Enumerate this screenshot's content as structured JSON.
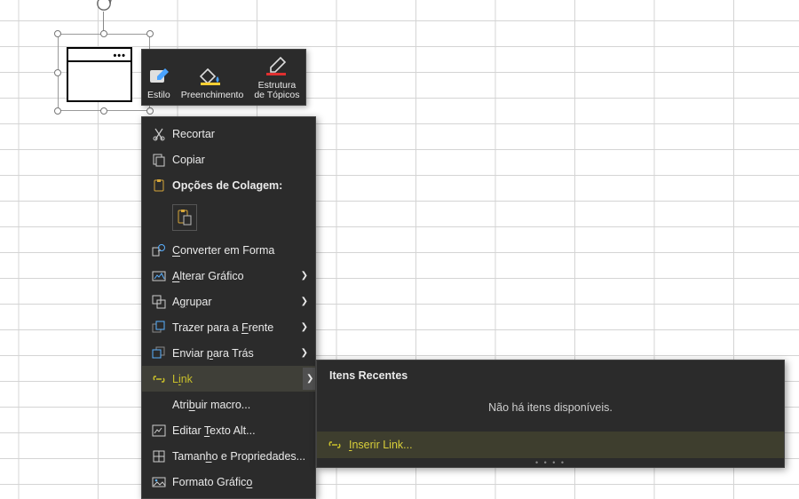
{
  "miniToolbar": {
    "style": "Estilo",
    "fill": "Preenchimento",
    "outline": "Estrutura\nde Tópicos"
  },
  "ctx": {
    "cut": "Recortar",
    "copy": "Copiar",
    "pasteOptions": "Opções de Colagem:",
    "convertToShape": "Converter em Forma",
    "changeGraphic": "Alterar Gráfico",
    "group": "Agrupar",
    "bringFront": "Trazer para a Frente",
    "sendBack": "Enviar para Trás",
    "link": "Link",
    "assignMacro": "Atribuir macro...",
    "editAltText": "Editar Texto Alt...",
    "sizeProps": "Tamanho e Propriedades...",
    "formatGraphic": "Formato Gráfico"
  },
  "submenu": {
    "recentHeader": "Itens Recentes",
    "noItems": "Não há itens disponíveis.",
    "insertLink": "Inserir Link..."
  }
}
